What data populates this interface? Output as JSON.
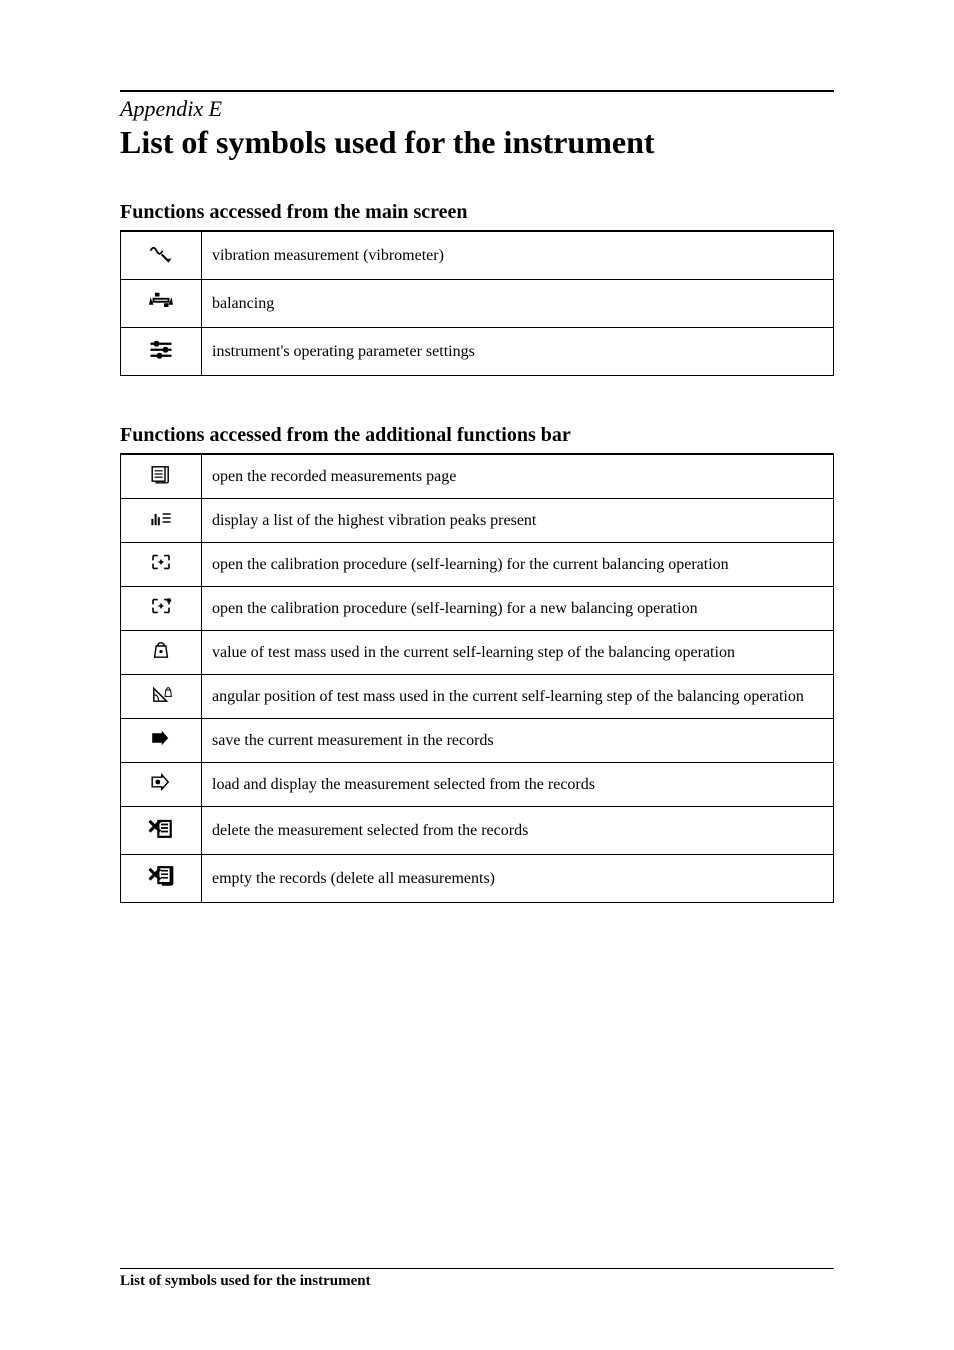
{
  "appendixLabel": "Appendix E",
  "pageTitle": "List of symbols used for the instrument",
  "section1Heading": "Functions accessed from the main screen",
  "section2Heading": "Functions accessed from the additional functions bar",
  "footerText": "List of symbols used for the instrument",
  "mainScreenFunctions": [
    {
      "iconName": "vibrometer-icon",
      "desc": "vibration measurement (vibrometer)"
    },
    {
      "iconName": "balancing-icon",
      "desc": "balancing"
    },
    {
      "iconName": "settings-icon",
      "desc": "instrument's operating parameter settings"
    }
  ],
  "additionalFunctions": [
    {
      "iconName": "records-page-icon",
      "desc": "open the recorded measurements page"
    },
    {
      "iconName": "peaks-list-icon",
      "desc": "display a list of the highest vibration peaks present"
    },
    {
      "iconName": "calibrate-current-icon",
      "desc": "open the calibration procedure (self-learning) for the current balancing operation",
      "justify": true
    },
    {
      "iconName": "calibrate-new-icon",
      "desc": "open the calibration procedure (self-learning) for a new balancing operation"
    },
    {
      "iconName": "test-mass-value-icon",
      "desc": "value of test mass used in the current self-learning step of the balancing operation",
      "justify": true
    },
    {
      "iconName": "test-mass-angle-icon",
      "desc": "angular position of test mass used in the current self-learning step of the balancing operation",
      "justify": true
    },
    {
      "iconName": "save-record-icon",
      "desc": "save the current measurement in the records"
    },
    {
      "iconName": "load-record-icon",
      "desc": "load and display the measurement selected from the records"
    },
    {
      "iconName": "delete-record-icon",
      "desc": "delete the measurement selected from the records"
    },
    {
      "iconName": "empty-records-icon",
      "desc": "empty the records (delete all measurements)"
    }
  ]
}
